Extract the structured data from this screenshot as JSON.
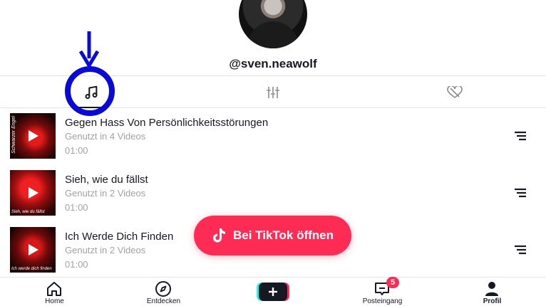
{
  "profile": {
    "username": "@sven.neawolf"
  },
  "tabs": [
    {
      "icon": "music-note-icon",
      "active": true
    },
    {
      "icon": "equalizer-icon",
      "active": false
    },
    {
      "icon": "heart-hidden-icon",
      "active": false
    }
  ],
  "sounds": [
    {
      "title": "Gegen Hass Von Persönlichkeitsstörungen",
      "used": "Genutzt in 4 Videos",
      "duration": "01:00",
      "thumb_caption": "Schwarzer Engel"
    },
    {
      "title": "Sieh, wie du fällst",
      "used": "Genutzt in 2 Videos",
      "duration": "01:00",
      "thumb_caption": "Sieh, wie du fällst"
    },
    {
      "title": "Ich Werde Dich Finden",
      "used": "Genutzt in 2 Videos",
      "duration": "01:00",
      "thumb_caption": "Ich werde dich finden"
    }
  ],
  "open_button": {
    "label": "Bei TikTok öffnen"
  },
  "bottom_nav": [
    {
      "label": "Home",
      "icon": "home-icon"
    },
    {
      "label": "Entdecken",
      "icon": "compass-icon"
    },
    {
      "label": "",
      "icon": "plus-icon"
    },
    {
      "label": "Posteingang",
      "icon": "inbox-icon",
      "badge": "5"
    },
    {
      "label": "Profil",
      "icon": "profile-icon",
      "active": true
    }
  ],
  "colors": {
    "accent": "#fe2c55",
    "annotation": "#0a0ad6",
    "text": "#161823",
    "muted": "#a1a2a7"
  }
}
